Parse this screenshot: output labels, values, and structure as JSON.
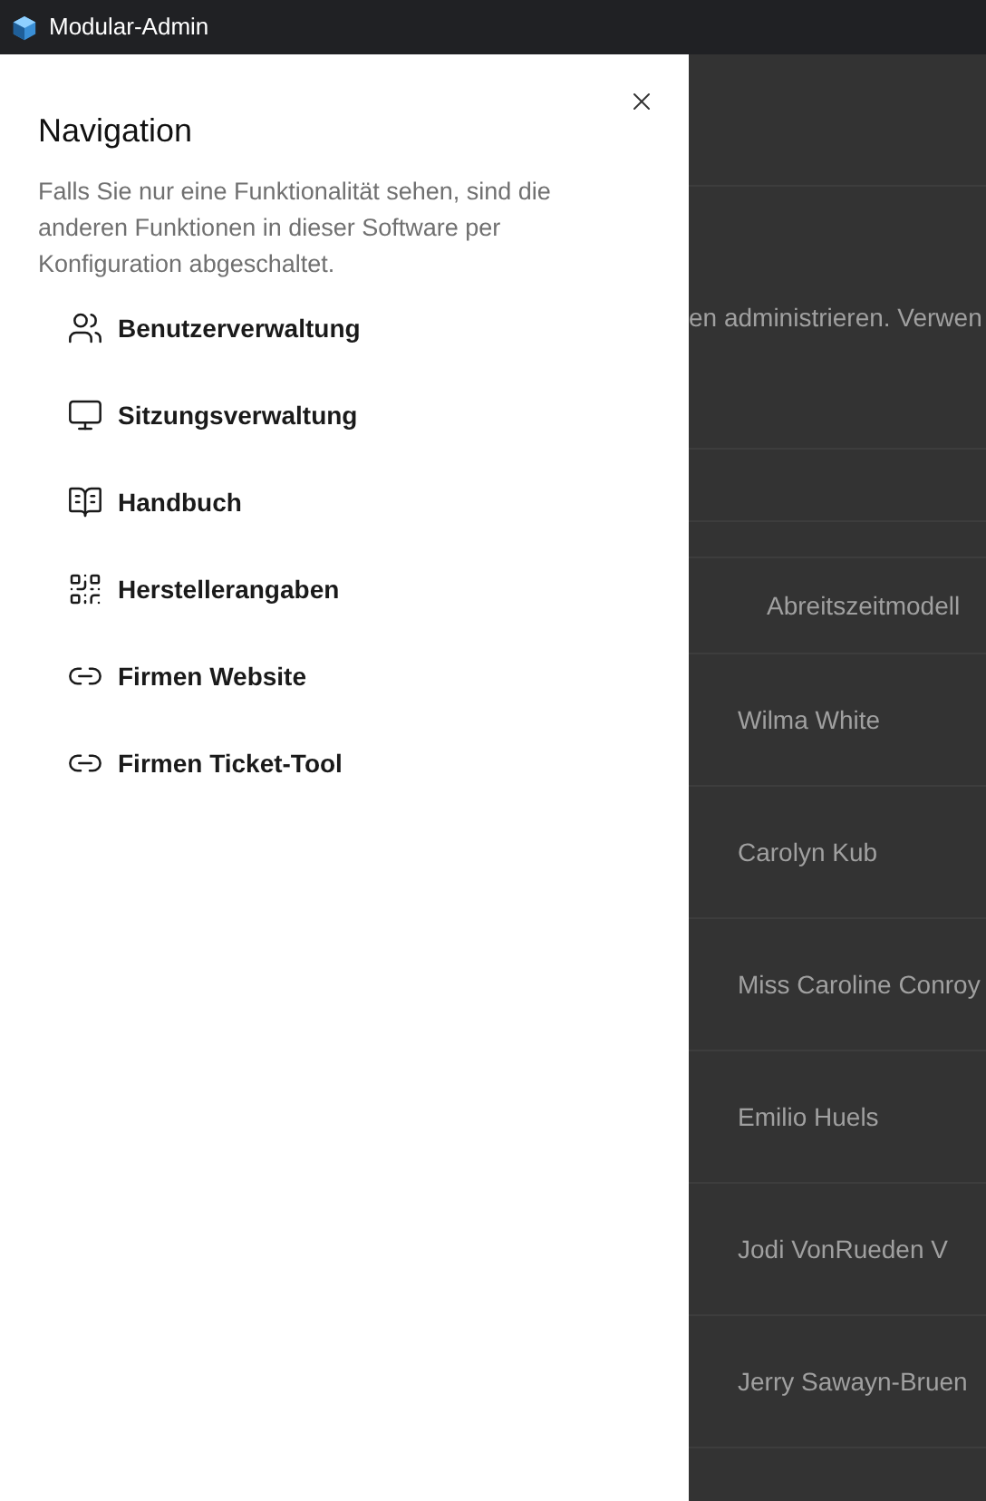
{
  "window": {
    "title": "Modular-Admin"
  },
  "drawer": {
    "title": "Navigation",
    "description": "Falls Sie nur eine Funktionalität sehen, sind die anderen Funktionen in dieser Software per Konfiguration abgeschaltet.",
    "items": [
      {
        "kind": "users",
        "label": "Benutzerverwaltung"
      },
      {
        "kind": "monitor",
        "label": "Sitzungsverwaltung"
      },
      {
        "kind": "book",
        "label": "Handbuch"
      },
      {
        "kind": "qr",
        "label": "Herstellerangaben"
      },
      {
        "kind": "link",
        "label": "Firmen Website"
      },
      {
        "kind": "link",
        "label": "Firmen Ticket-Tool"
      }
    ]
  },
  "background": {
    "intro": "en administrieren. Verwen",
    "table": {
      "column_header": "Abreitszeitmodell",
      "rows": [
        "Wilma White",
        "Carolyn Kub",
        "Miss Caroline Conroy",
        "Emilio Huels",
        "Jodi VonRueden V",
        "Jerry Sawayn-Bruen"
      ]
    }
  }
}
